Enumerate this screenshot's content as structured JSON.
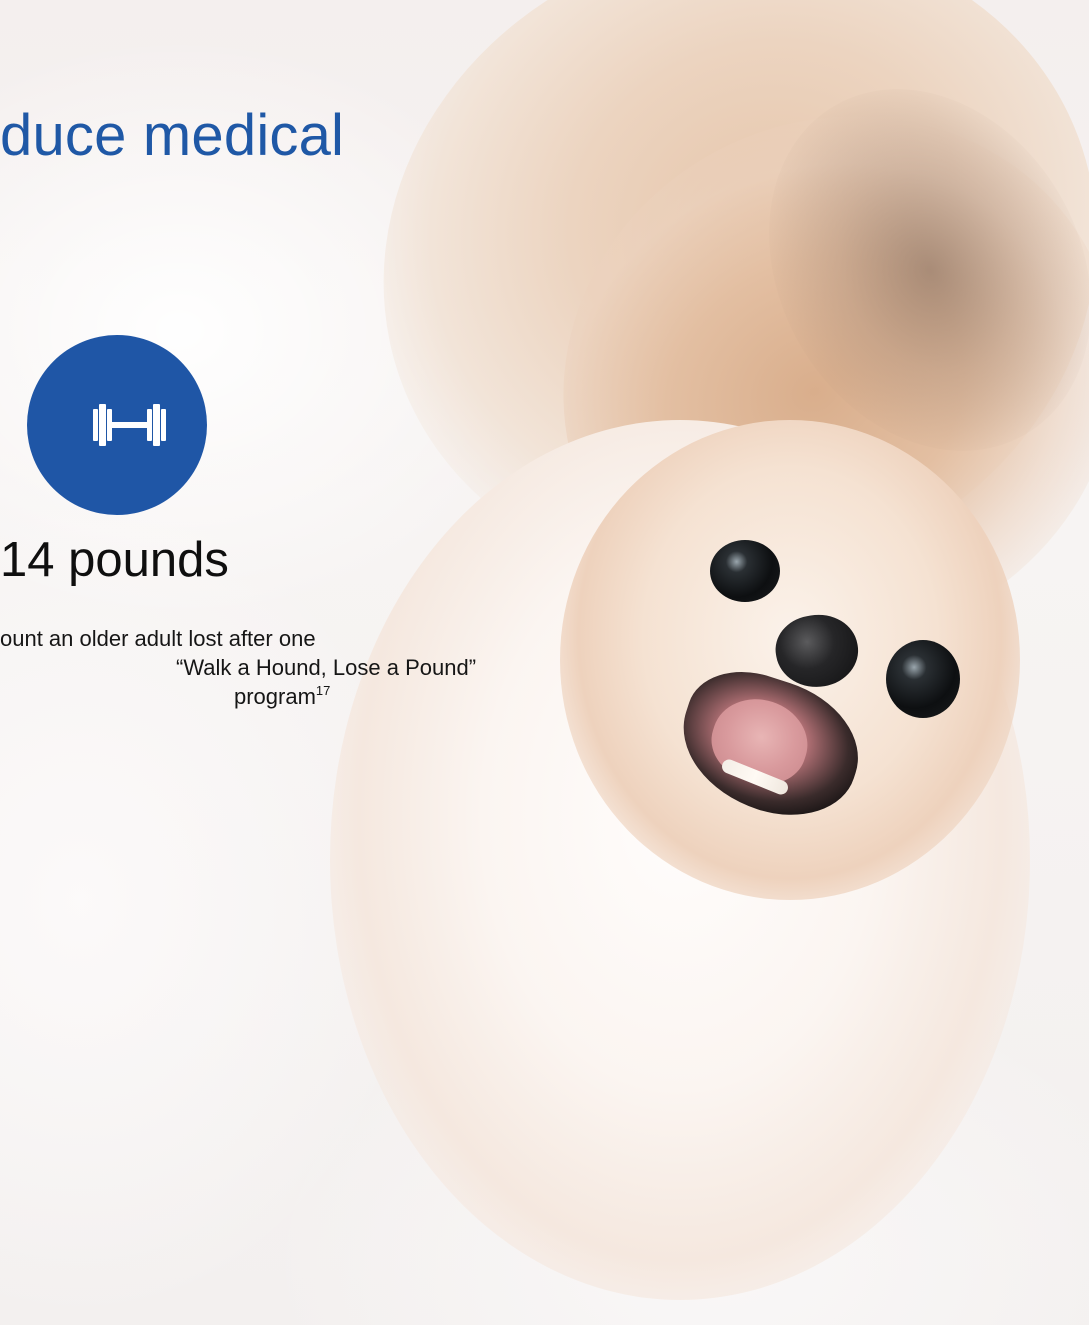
{
  "slide": {
    "title": "duce medical",
    "stat": {
      "icon": "dumbbell-icon",
      "value": "14 pounds",
      "description_lines": [
        "ount an older adult lost after one",
        "“Walk a Hound, Lose a Pound”",
        "program"
      ],
      "footnote": "17"
    }
  },
  "colors": {
    "accent": "#1f56a6",
    "title_text": "#1f58a6",
    "body_text": "#111111"
  }
}
